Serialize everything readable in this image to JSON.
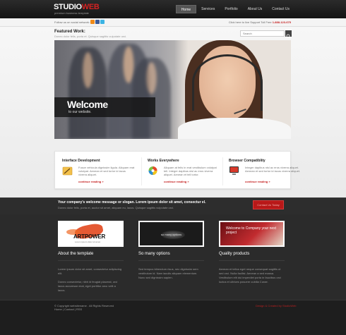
{
  "header": {
    "logo_main": "STUDIO",
    "logo_accent": "WEB",
    "tagline": "premium business template",
    "nav": [
      "Home",
      "Services",
      "Portfolio",
      "About Us",
      "Contact Us"
    ]
  },
  "subbar": {
    "follow_text": "Follow us on social network:",
    "social_icons": [
      "rss-icon",
      "facebook-icon",
      "twitter-icon"
    ],
    "support_text": "Click here to live Support Toll Free",
    "phone": "1-888-123-675"
  },
  "featured": {
    "title": "Featured Work:",
    "subtitle": "Donec dolor felis, porta et. Quisque sagittis vulputate orci.",
    "search_placeholder": "Search"
  },
  "slider": {
    "title": "Welcome",
    "subtitle": "to our website."
  },
  "features": [
    {
      "title": "Interface Development",
      "text": "Fusce vehicula dignissim ligula. Aliquam erat volutpat. Aenean et sed tortor id lacus viverra aliquet.",
      "more": "continue reading »"
    },
    {
      "title": "Works Everywhere",
      "text": "Aliquam at felis in erat vestibulum volutpat tell. Integer dapibus nisl ac eros viverra aliquet. Aenean et tell tortor.",
      "more": "continue reading »"
    },
    {
      "title": "Browser Compatiblity",
      "text": "Integer dapibus nisl ac eros viverra aliquet. Aenean et sed tortor id lacus viverra aliquet.",
      "more": "continue reading »"
    }
  ],
  "message": {
    "title": "Your company's welcome message or slogan. Lorem ipsum dolor sit amet, consectur el.",
    "subtitle": "Donec dolor felis, porta et, auctor sit amet, aliquam eu, lacus. Quisque sagittis vulputate orci.",
    "button": "Contact Us Today"
  },
  "columns": [
    {
      "thumb_title": "ARTPOWER",
      "thumb_sub": "Lorem ipsum dolor sit amet",
      "title": "About the template",
      "text1": "Lorem ipsum dolor sit amet, consectetur adipiscing elit.",
      "text2": "Donec consectetur, nibh id feugiat placerat, orci lacus accumsan erat, eget porttitor arcu velit a lacus."
    },
    {
      "thumb_title": "so many options",
      "title": "So many options",
      "text1": "Sed tempus bibendum risus, nec dignissim sem vestibulum id. Nam iaculis aliquam elementum. Nunc sed dignissim sapien."
    },
    {
      "thumb_title": "Welcome to Company your next project",
      "title": "Quality products",
      "text1": "Aenean et tellus eget neque consequat sagittis ut sed orci. Nulla facilisi. Aenean a sed massa. Vestibulum elit dui imperdiet porta in faucibus orci luctus et ultrices posuere cubilia Curae."
    }
  ],
  "footer": {
    "copyright": "© Copyright websitename . All Rights Reserved",
    "links": "Home | Contact | RSS",
    "right": "Design & Created by StudioWeb"
  },
  "colors": {
    "accent": "#c41e1e",
    "dark_bg": "#2b2b2b"
  }
}
